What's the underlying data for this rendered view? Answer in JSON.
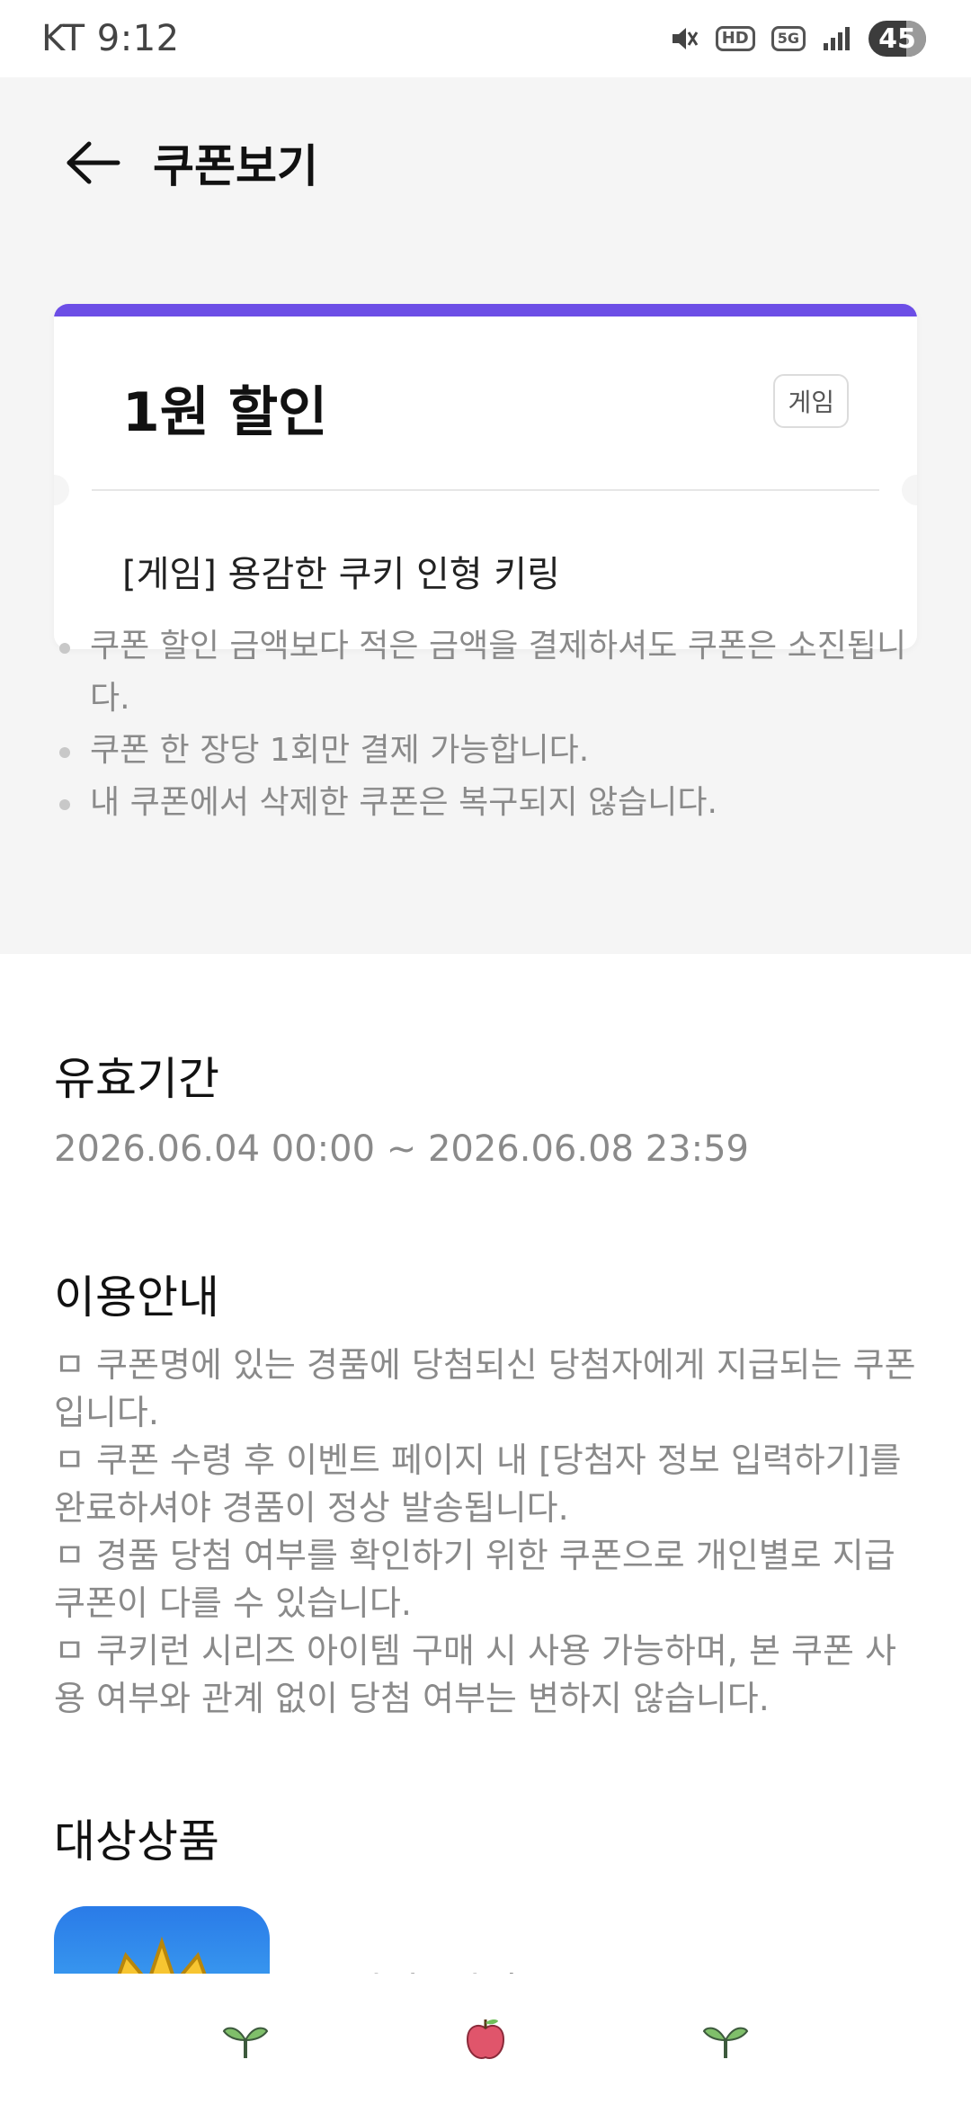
{
  "status_bar": {
    "carrier_time": "KT 9:12",
    "icons": [
      "mute-icon",
      "hd-icon",
      "5g-icon",
      "signal-icon"
    ],
    "hd_label": "HD",
    "network_label": "5G",
    "battery_level": "45"
  },
  "header": {
    "back_icon": "arrow-left-icon",
    "title": "쿠폰보기"
  },
  "coupon": {
    "accent_color": "#6c4ee6",
    "amount": "1원 할인",
    "tag": "게임",
    "product": "[게임] 용감한 쿠키 인형 키링"
  },
  "notices": [
    "쿠폰 할인 금액보다 적은 금액을 결제하셔도 쿠폰은 소진됩니다.",
    "쿠폰 한 장당 1회만 결제 가능합니다.",
    "내 쿠폰에서 삭제한 쿠폰은 복구되지 않습니다."
  ],
  "validity": {
    "title": "유효기간",
    "period": "2026.06.04 00:00 ~ 2026.06.08 23:59"
  },
  "usage": {
    "title": "이용안내",
    "lines": [
      "ㅁ 쿠폰명에 있는 경품에 당첨되신 당첨자에게 지급되는 쿠폰입니다.",
      "ㅁ 쿠폰 수령 후 이벤트 페이지 내 [당첨자 정보 입력하기]를 완료하셔야 경품이 정상 발송됩니다.",
      "ㅁ 경품 당첨 여부를 확인하기 위한 쿠폰으로 개인별로 지급 쿠폰이 다를 수 있습니다.",
      "ㅁ 쿠키런 시리즈 아이템 구매 시 사용 가능하며, 본 쿠폰 사용 여부와 관계 없이 당첨 여부는 변하지 않습니다."
    ]
  },
  "target_products": {
    "title": "대상상품",
    "items": [
      {
        "name": "쿠키런: 킹덤",
        "icon": "game-app-icon"
      }
    ]
  },
  "bottom_nav": {
    "items": [
      {
        "icon": "sprout-icon"
      },
      {
        "icon": "apple-icon"
      },
      {
        "icon": "sprout-icon"
      }
    ]
  }
}
